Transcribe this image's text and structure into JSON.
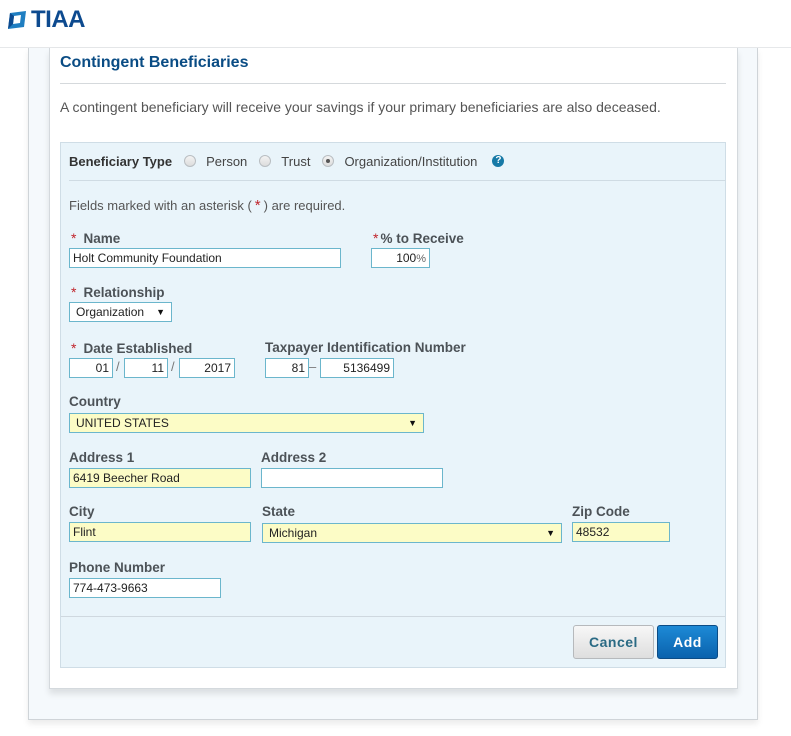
{
  "header": {
    "logo_text": "TIAA"
  },
  "section": {
    "title": "Contingent Beneficiaries",
    "intro": "A contingent beneficiary will receive your savings if your primary beneficiaries are also deceased."
  },
  "beneficiary_type": {
    "label": "Beneficiary Type",
    "options": [
      {
        "label": "Person",
        "checked": false
      },
      {
        "label": "Trust",
        "checked": false
      },
      {
        "label": "Organization/Institution",
        "checked": true
      }
    ],
    "help_icon": "?"
  },
  "required_note": {
    "prefix": "Fields marked with an asterisk (",
    "star": "*",
    "suffix": ") are required."
  },
  "required_star": "*",
  "fields": {
    "name": {
      "label": "Name",
      "value": "Holt Community Foundation"
    },
    "percent": {
      "label": "% to Receive",
      "value": "100",
      "suffix": "%"
    },
    "relationship": {
      "label": "Relationship",
      "value": "Organization"
    },
    "date_established": {
      "label": "Date Established",
      "month": "01",
      "day": "11",
      "year": "2017",
      "separator": "/"
    },
    "tin": {
      "label": "Taxpayer Identification Number",
      "part1": "81",
      "part2": "5136499",
      "separator": "–"
    },
    "country": {
      "label": "Country",
      "value": "UNITED STATES"
    },
    "address1": {
      "label": "Address 1",
      "value": "6419 Beecher Road"
    },
    "address2": {
      "label": "Address 2",
      "value": ""
    },
    "city": {
      "label": "City",
      "value": "Flint"
    },
    "state": {
      "label": "State",
      "value": "Michigan"
    },
    "zip": {
      "label": "Zip Code",
      "value": "48532"
    },
    "phone": {
      "label": "Phone Number",
      "value": "774-473-9663"
    }
  },
  "caret_glyph": "▼",
  "buttons": {
    "cancel": "Cancel",
    "add": "Add"
  }
}
